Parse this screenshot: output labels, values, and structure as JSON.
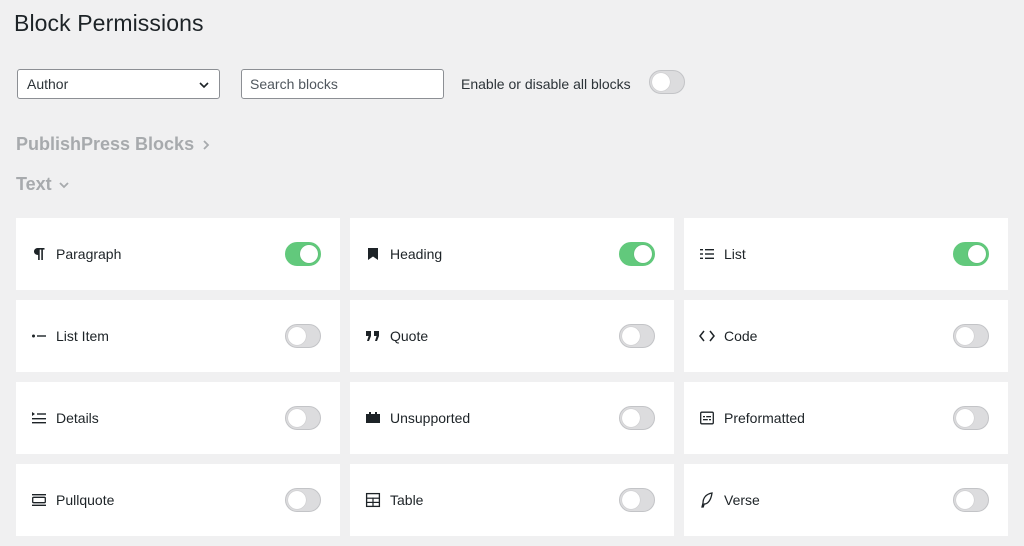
{
  "page": {
    "title": "Block Permissions"
  },
  "toolbar": {
    "role_select": {
      "value": "Author"
    },
    "search": {
      "placeholder": "Search blocks",
      "value": ""
    },
    "toggle_all_label": "Enable or disable all blocks",
    "toggle_all_on": false
  },
  "sections": {
    "publishpress": "PublishPress Blocks",
    "text": "Text"
  },
  "colors": {
    "toggle_on": "#62c97c",
    "toggle_off": "#dcdcde"
  },
  "blocks": [
    {
      "label": "Paragraph",
      "icon": "paragraph-icon",
      "enabled": true
    },
    {
      "label": "Heading",
      "icon": "bookmark-icon",
      "enabled": true
    },
    {
      "label": "List",
      "icon": "list-icon",
      "enabled": true
    },
    {
      "label": "List Item",
      "icon": "list-item-icon",
      "enabled": false
    },
    {
      "label": "Quote",
      "icon": "quote-icon",
      "enabled": false
    },
    {
      "label": "Code",
      "icon": "code-icon",
      "enabled": false
    },
    {
      "label": "Details",
      "icon": "details-icon",
      "enabled": false
    },
    {
      "label": "Unsupported",
      "icon": "unsupported-icon",
      "enabled": false
    },
    {
      "label": "Preformatted",
      "icon": "preformatted-icon",
      "enabled": false
    },
    {
      "label": "Pullquote",
      "icon": "pullquote-icon",
      "enabled": false
    },
    {
      "label": "Table",
      "icon": "table-icon",
      "enabled": false
    },
    {
      "label": "Verse",
      "icon": "verse-icon",
      "enabled": false
    }
  ]
}
